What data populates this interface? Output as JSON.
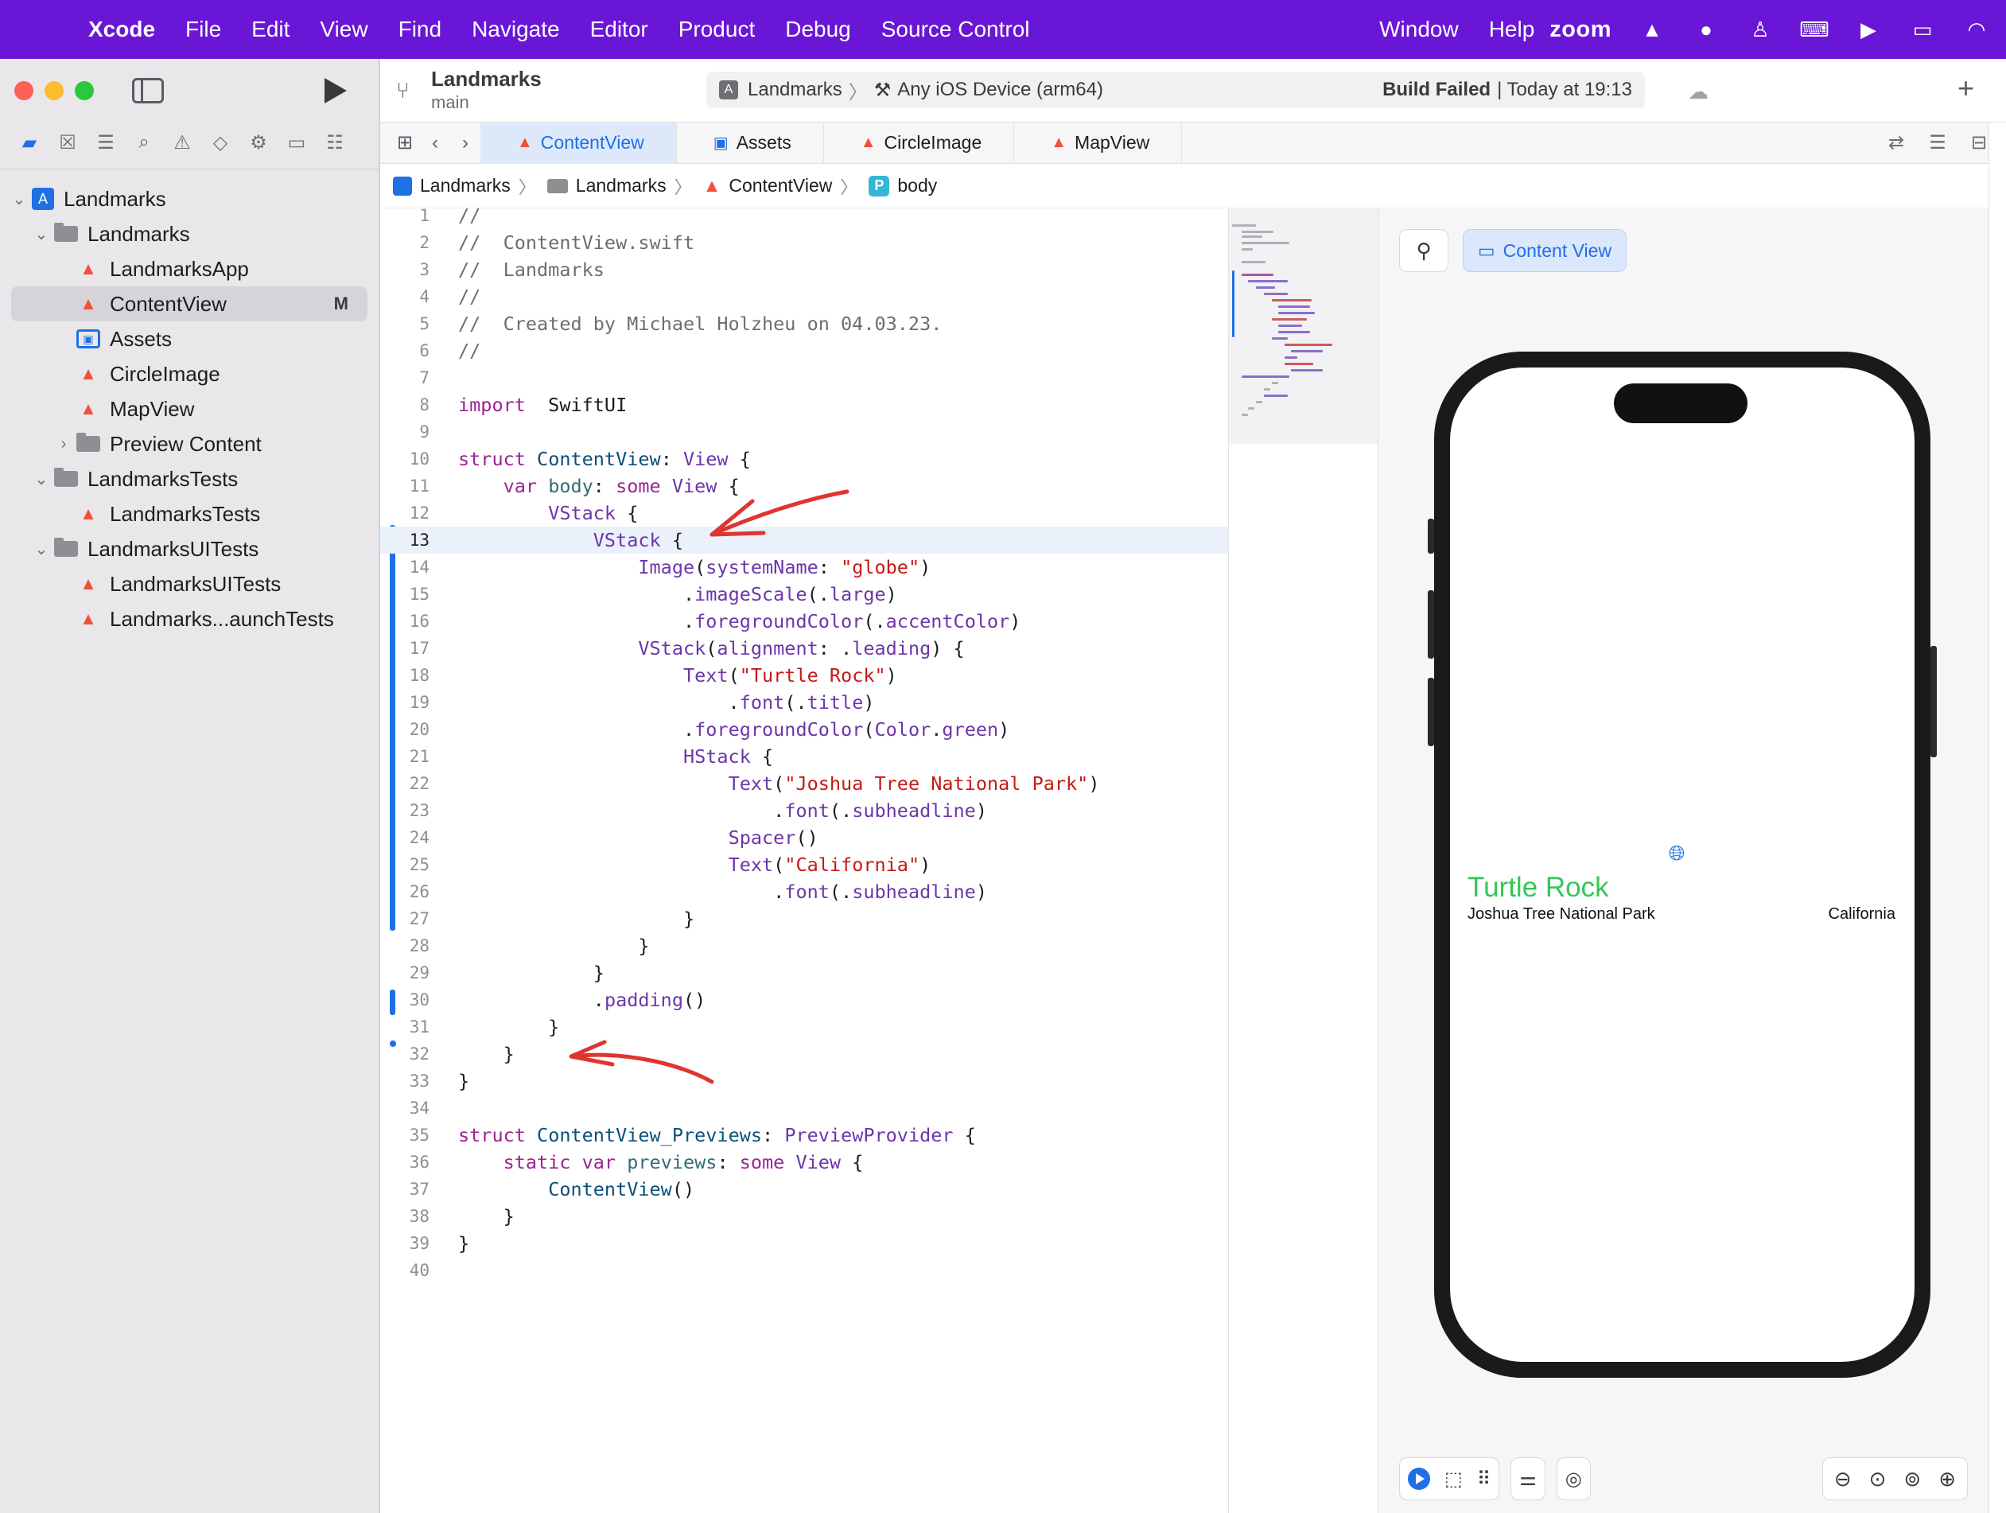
{
  "menubar": {
    "app": "Xcode",
    "items": [
      "File",
      "Edit",
      "View",
      "Find",
      "Navigate",
      "Editor",
      "Product",
      "Debug",
      "Source Control"
    ],
    "right_items": [
      "Window",
      "Help"
    ],
    "zoom": "zoom"
  },
  "toolbar": {
    "project": "Landmarks",
    "branch": "main",
    "scheme": "Landmarks",
    "destination": "Any iOS Device (arm64)",
    "status_bold": "Build Failed",
    "status_rest": "| Today at 19:13"
  },
  "navigator": {
    "tree": [
      {
        "label": "Landmarks",
        "type": "project",
        "depth": 0,
        "chevron": "down"
      },
      {
        "label": "Landmarks",
        "type": "folder",
        "depth": 1,
        "chevron": "down"
      },
      {
        "label": "LandmarksApp",
        "type": "swift",
        "depth": 2
      },
      {
        "label": "ContentView",
        "type": "swift",
        "depth": 2,
        "selected": true,
        "badge": "M"
      },
      {
        "label": "Assets",
        "type": "assets",
        "depth": 2
      },
      {
        "label": "CircleImage",
        "type": "swift",
        "depth": 2
      },
      {
        "label": "MapView",
        "type": "swift",
        "depth": 2
      },
      {
        "label": "Preview Content",
        "type": "folder",
        "depth": 2,
        "chevron": "right"
      },
      {
        "label": "LandmarksTests",
        "type": "folder",
        "depth": 1,
        "chevron": "down"
      },
      {
        "label": "LandmarksTests",
        "type": "swift",
        "depth": 2
      },
      {
        "label": "LandmarksUITests",
        "type": "folder",
        "depth": 1,
        "chevron": "down"
      },
      {
        "label": "LandmarksUITests",
        "type": "swift",
        "depth": 2
      },
      {
        "label": "Landmarks...aunchTests",
        "type": "swift",
        "depth": 2
      }
    ]
  },
  "tabs": [
    {
      "label": "ContentView",
      "icon": "swift",
      "active": true
    },
    {
      "label": "Assets",
      "icon": "assets"
    },
    {
      "label": "CircleImage",
      "icon": "swift"
    },
    {
      "label": "MapView",
      "icon": "swift"
    }
  ],
  "breadcrumb": [
    "Landmarks",
    "Landmarks",
    "ContentView",
    "body"
  ],
  "editor": {
    "current_line": 13,
    "lines": [
      [
        [
          "cm",
          "//"
        ]
      ],
      [
        [
          "cm",
          "//  ContentView.swift"
        ]
      ],
      [
        [
          "cm",
          "//  Landmarks"
        ]
      ],
      [
        [
          "cm",
          "//"
        ]
      ],
      [
        [
          "cm",
          "//  Created by Michael Holzheu on 04.03.23."
        ]
      ],
      [
        [
          "cm",
          "//"
        ]
      ],
      [],
      [
        [
          "k",
          "import"
        ],
        [
          "",
          "  SwiftUI"
        ]
      ],
      [],
      [
        [
          "k",
          "struct"
        ],
        [
          "",
          " "
        ],
        [
          "t",
          "ContentView"
        ],
        [
          "",
          ": "
        ],
        [
          "p",
          "View"
        ],
        [
          "",
          " {"
        ]
      ],
      [
        [
          "",
          "    "
        ],
        [
          "k",
          "var"
        ],
        [
          "",
          " "
        ],
        [
          "f",
          "body"
        ],
        [
          "",
          ": "
        ],
        [
          "k",
          "some"
        ],
        [
          "",
          " "
        ],
        [
          "p",
          "View"
        ],
        [
          "",
          " {"
        ]
      ],
      [
        [
          "",
          "        "
        ],
        [
          "p",
          "VStack"
        ],
        [
          "",
          " {"
        ]
      ],
      [
        [
          "",
          "            "
        ],
        [
          "p",
          "VStack"
        ],
        [
          "",
          " {"
        ]
      ],
      [
        [
          "",
          "                "
        ],
        [
          "p",
          "Image"
        ],
        [
          "",
          "("
        ],
        [
          "p",
          "systemName"
        ],
        [
          "",
          ": "
        ],
        [
          "s",
          "\"globe\""
        ],
        [
          "",
          ")"
        ]
      ],
      [
        [
          "",
          "                    ."
        ],
        [
          "p",
          "imageScale"
        ],
        [
          "",
          "(."
        ],
        [
          "p",
          "large"
        ],
        [
          "",
          ")"
        ]
      ],
      [
        [
          "",
          "                    ."
        ],
        [
          "p",
          "foregroundColor"
        ],
        [
          "",
          "(."
        ],
        [
          "p",
          "accentColor"
        ],
        [
          "",
          ")"
        ]
      ],
      [
        [
          "",
          "                "
        ],
        [
          "p",
          "VStack"
        ],
        [
          "",
          "("
        ],
        [
          "p",
          "alignment"
        ],
        [
          "",
          ": ."
        ],
        [
          "p",
          "leading"
        ],
        [
          "",
          ") {"
        ]
      ],
      [
        [
          "",
          "                    "
        ],
        [
          "p",
          "Text"
        ],
        [
          "",
          "("
        ],
        [
          "s",
          "\"Turtle Rock\""
        ],
        [
          "",
          ")"
        ]
      ],
      [
        [
          "",
          "                        ."
        ],
        [
          "p",
          "font"
        ],
        [
          "",
          "(."
        ],
        [
          "p",
          "title"
        ],
        [
          "",
          ")"
        ]
      ],
      [
        [
          "",
          "                    ."
        ],
        [
          "p",
          "foregroundColor"
        ],
        [
          "",
          "("
        ],
        [
          "p",
          "Color"
        ],
        [
          "",
          "."
        ],
        [
          "p",
          "green"
        ],
        [
          "",
          ")"
        ]
      ],
      [
        [
          "",
          "                    "
        ],
        [
          "p",
          "HStack"
        ],
        [
          "",
          " {"
        ]
      ],
      [
        [
          "",
          "                        "
        ],
        [
          "p",
          "Text"
        ],
        [
          "",
          "("
        ],
        [
          "s",
          "\"Joshua Tree National Park\""
        ],
        [
          "",
          ")"
        ]
      ],
      [
        [
          "",
          "                            ."
        ],
        [
          "p",
          "font"
        ],
        [
          "",
          "(."
        ],
        [
          "p",
          "subheadline"
        ],
        [
          "",
          ")"
        ]
      ],
      [
        [
          "",
          "                        "
        ],
        [
          "p",
          "Spacer"
        ],
        [
          "",
          "()"
        ]
      ],
      [
        [
          "",
          "                        "
        ],
        [
          "p",
          "Text"
        ],
        [
          "",
          "("
        ],
        [
          "s",
          "\"California\""
        ],
        [
          "",
          ")"
        ]
      ],
      [
        [
          "",
          "                            ."
        ],
        [
          "p",
          "font"
        ],
        [
          "",
          "(."
        ],
        [
          "p",
          "subheadline"
        ],
        [
          "",
          ")"
        ]
      ],
      [
        [
          "",
          "                    }"
        ]
      ],
      [
        [
          "",
          "                }"
        ]
      ],
      [
        [
          "",
          "            }"
        ]
      ],
      [
        [
          "",
          "            ."
        ],
        [
          "p",
          "padding"
        ],
        [
          "",
          "()"
        ]
      ],
      [
        [
          "",
          "        }"
        ]
      ],
      [
        [
          "",
          "    }"
        ]
      ],
      [
        [
          "",
          "}"
        ]
      ],
      [],
      [
        [
          "k",
          "struct"
        ],
        [
          "",
          " "
        ],
        [
          "t",
          "ContentView_Previews"
        ],
        [
          "",
          ": "
        ],
        [
          "p",
          "PreviewProvider"
        ],
        [
          "",
          " {"
        ]
      ],
      [
        [
          "",
          "    "
        ],
        [
          "k",
          "static"
        ],
        [
          "",
          " "
        ],
        [
          "k",
          "var"
        ],
        [
          "",
          " "
        ],
        [
          "f",
          "previews"
        ],
        [
          "",
          ": "
        ],
        [
          "k",
          "some"
        ],
        [
          "",
          " "
        ],
        [
          "p",
          "View"
        ],
        [
          "",
          " {"
        ]
      ],
      [
        [
          "",
          "        "
        ],
        [
          "t",
          "ContentView"
        ],
        [
          "",
          "()"
        ]
      ],
      [
        [
          "",
          "    }"
        ]
      ],
      [
        [
          "",
          "}"
        ]
      ],
      []
    ]
  },
  "canvas": {
    "preview_label": "Content View",
    "title": "Turtle Rock",
    "park": "Joshua Tree National Park",
    "state": "California"
  },
  "colors": {
    "menubar": "#6a16d6",
    "accent": "#1f6fe5",
    "title_green": "#34c759",
    "annotation_red": "#e0342f"
  }
}
